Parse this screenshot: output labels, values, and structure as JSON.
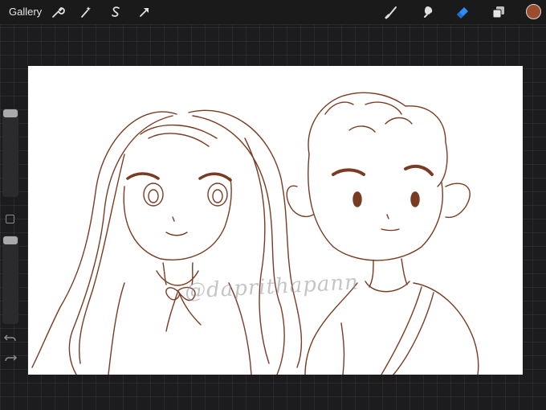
{
  "topbar": {
    "gallery_label": "Gallery",
    "left_tools": [
      "wrench-icon",
      "magic-wand-icon",
      "selection-s-icon",
      "transform-arrow-icon"
    ],
    "right_tools": [
      "brush-icon",
      "smudge-icon",
      "eraser-icon",
      "layers-icon"
    ],
    "active_tool": "eraser-icon",
    "active_tool_color": "#2f8ef5",
    "current_color": "#9a4d2f"
  },
  "sidebar": {
    "brush_size_level": 0.0,
    "opacity_level": 0.0,
    "undo_icon": "undo-arrow-icon",
    "redo_icon": "redo-arrow-icon"
  },
  "canvas": {
    "background": "#ffffff",
    "stroke_color": "#7a3b22",
    "watermark_text": "@daprithapann"
  }
}
